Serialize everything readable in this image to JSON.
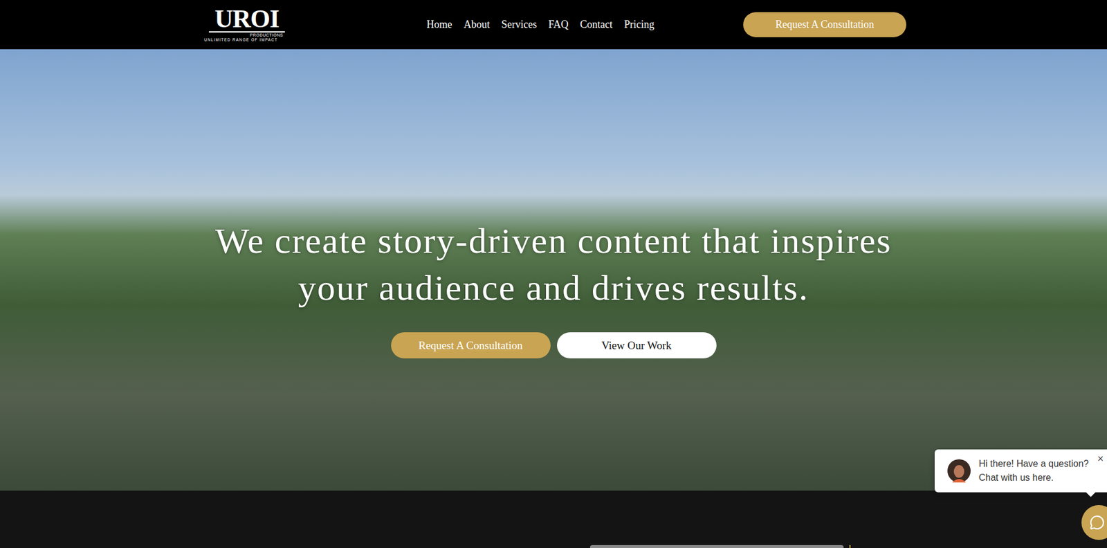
{
  "logo": {
    "name": "UROI",
    "sub": "PRODUCTIONS",
    "tagline": "UNLIMITED RANGE OF IMPACT"
  },
  "nav": {
    "links": [
      "Home",
      "About",
      "Services",
      "FAQ",
      "Contact",
      "Pricing"
    ],
    "cta": "Request A Consultation"
  },
  "hero": {
    "heading": "We create story-driven content that inspires your audience and drives results.",
    "buttons": [
      {
        "label": "Request A Consultation",
        "kind": "primary"
      },
      {
        "label": "View Our Work",
        "kind": "secondary"
      }
    ]
  },
  "chat": {
    "lines": [
      "Hi there! Have a question?",
      "Chat with us here."
    ],
    "close": "×"
  }
}
